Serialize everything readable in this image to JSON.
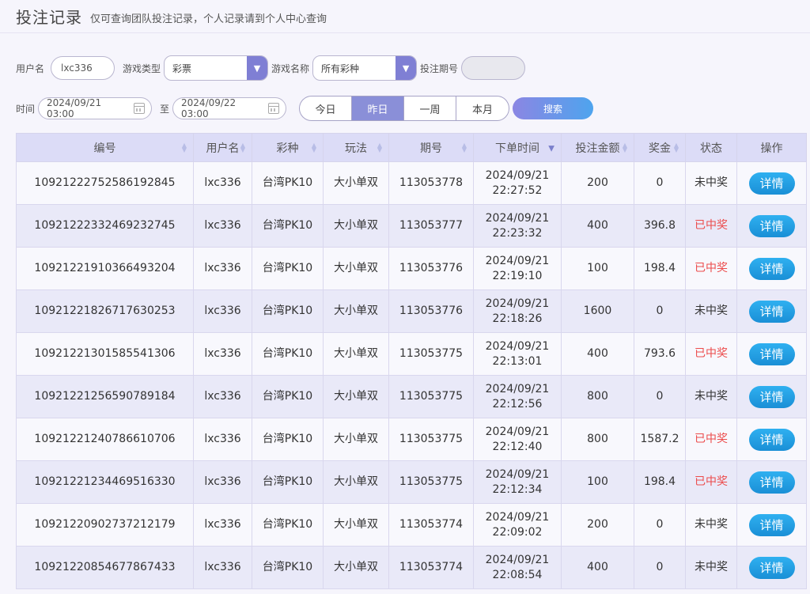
{
  "header": {
    "title": "投注记录",
    "subtitle": "仅可查询团队投注记录，个人记录请到个人中心查询"
  },
  "filters": {
    "username_label": "用户名",
    "username_value": "lxc336",
    "game_type_label": "游戏类型",
    "game_type_value": "彩票",
    "game_name_label": "游戏名称",
    "game_name_value": "所有彩种",
    "period_label": "投注期号",
    "period_value": "",
    "time_label": "时间",
    "start_date": "2024/09/21 03:00",
    "to_label": "至",
    "end_date": "2024/09/22 03:00",
    "quick_ranges": [
      "今日",
      "昨日",
      "一周",
      "本月"
    ],
    "active_range": "昨日",
    "search_label": "搜索"
  },
  "table": {
    "columns": [
      "编号",
      "用户名",
      "彩种",
      "玩法",
      "期号",
      "下单时间",
      "投注金额",
      "奖金",
      "状态",
      "操作"
    ],
    "detail_label": "详情",
    "rows": [
      {
        "id": "10921222752586192845",
        "user": "lxc336",
        "game": "台湾PK10",
        "play": "大小单双",
        "period": "113053778",
        "date": "2024/09/21",
        "time": "22:27:52",
        "amount": "200",
        "prize": "0",
        "status": "未中奖",
        "win": false
      },
      {
        "id": "10921222332469232745",
        "user": "lxc336",
        "game": "台湾PK10",
        "play": "大小单双",
        "period": "113053777",
        "date": "2024/09/21",
        "time": "22:23:32",
        "amount": "400",
        "prize": "396.8",
        "status": "已中奖",
        "win": true
      },
      {
        "id": "10921221910366493204",
        "user": "lxc336",
        "game": "台湾PK10",
        "play": "大小单双",
        "period": "113053776",
        "date": "2024/09/21",
        "time": "22:19:10",
        "amount": "100",
        "prize": "198.4",
        "status": "已中奖",
        "win": true
      },
      {
        "id": "10921221826717630253",
        "user": "lxc336",
        "game": "台湾PK10",
        "play": "大小单双",
        "period": "113053776",
        "date": "2024/09/21",
        "time": "22:18:26",
        "amount": "1600",
        "prize": "0",
        "status": "未中奖",
        "win": false
      },
      {
        "id": "10921221301585541306",
        "user": "lxc336",
        "game": "台湾PK10",
        "play": "大小单双",
        "period": "113053775",
        "date": "2024/09/21",
        "time": "22:13:01",
        "amount": "400",
        "prize": "793.6",
        "status": "已中奖",
        "win": true
      },
      {
        "id": "10921221256590789184",
        "user": "lxc336",
        "game": "台湾PK10",
        "play": "大小单双",
        "period": "113053775",
        "date": "2024/09/21",
        "time": "22:12:56",
        "amount": "800",
        "prize": "0",
        "status": "未中奖",
        "win": false
      },
      {
        "id": "10921221240786610706",
        "user": "lxc336",
        "game": "台湾PK10",
        "play": "大小单双",
        "period": "113053775",
        "date": "2024/09/21",
        "time": "22:12:40",
        "amount": "800",
        "prize": "1587.2",
        "status": "已中奖",
        "win": true
      },
      {
        "id": "10921221234469516330",
        "user": "lxc336",
        "game": "台湾PK10",
        "play": "大小单双",
        "period": "113053775",
        "date": "2024/09/21",
        "time": "22:12:34",
        "amount": "100",
        "prize": "198.4",
        "status": "已中奖",
        "win": true
      },
      {
        "id": "10921220902737212179",
        "user": "lxc336",
        "game": "台湾PK10",
        "play": "大小单双",
        "period": "113053774",
        "date": "2024/09/21",
        "time": "22:09:02",
        "amount": "200",
        "prize": "0",
        "status": "未中奖",
        "win": false
      },
      {
        "id": "10921220854677867433",
        "user": "lxc336",
        "game": "台湾PK10",
        "play": "大小单双",
        "period": "113053774",
        "date": "2024/09/21",
        "time": "22:08:54",
        "amount": "400",
        "prize": "0",
        "status": "未中奖",
        "win": false
      }
    ]
  },
  "icons": {
    "select_arrow": "triangle-down-icon",
    "calendar": "calendar-icon",
    "sort": "sort-icon"
  },
  "colors": {
    "accent": "#8a8fd8",
    "win": "#ec4b4b",
    "detail_button": "#1a8fd6"
  }
}
